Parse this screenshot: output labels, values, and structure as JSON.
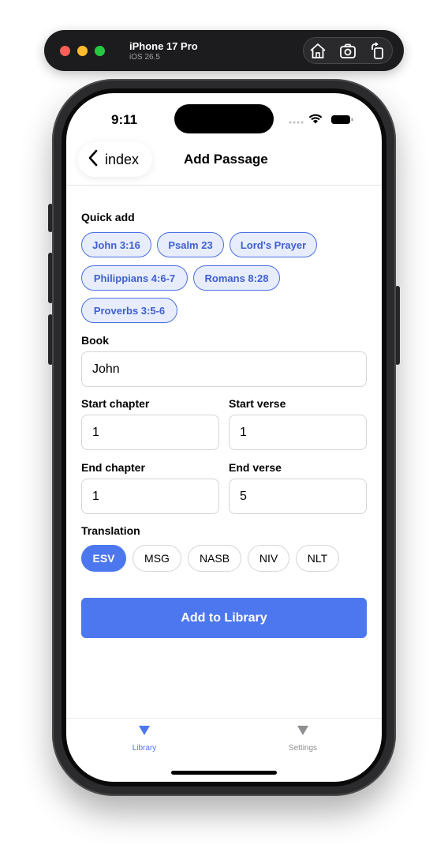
{
  "simulator": {
    "device_name": "iPhone 17 Pro",
    "os_version": "iOS 26.5",
    "buttons": [
      "home-icon",
      "screenshot-icon",
      "rotate-icon"
    ]
  },
  "status_bar": {
    "time": "9:11",
    "icons": [
      "cellular-dots-icon",
      "wifi-icon",
      "battery-icon"
    ]
  },
  "nav": {
    "back_label": "index",
    "title": "Add Passage"
  },
  "quick_add": {
    "label": "Quick add",
    "chips": [
      "John 3:16",
      "Psalm 23",
      "Lord's Prayer",
      "Philippians 4:6-7",
      "Romans 8:28",
      "Proverbs 3:5-6"
    ]
  },
  "form": {
    "book": {
      "label": "Book",
      "value": "John"
    },
    "start_chapter": {
      "label": "Start chapter",
      "value": "1"
    },
    "start_verse": {
      "label": "Start verse",
      "value": "1"
    },
    "end_chapter": {
      "label": "End chapter",
      "value": "1"
    },
    "end_verse": {
      "label": "End verse",
      "value": "5"
    }
  },
  "translation": {
    "label": "Translation",
    "options": [
      "ESV",
      "MSG",
      "NASB",
      "NIV",
      "NLT"
    ],
    "selected": "ESV"
  },
  "submit": {
    "label": "Add to Library"
  },
  "tab_bar": {
    "tabs": [
      {
        "label": "Library",
        "active": true
      },
      {
        "label": "Settings",
        "active": false
      }
    ]
  },
  "colors": {
    "accent": "#4d77ee",
    "chip_bg": "#e7edfd",
    "chip_text": "#3f5fcf",
    "inactive_tab": "#8e8e93"
  }
}
